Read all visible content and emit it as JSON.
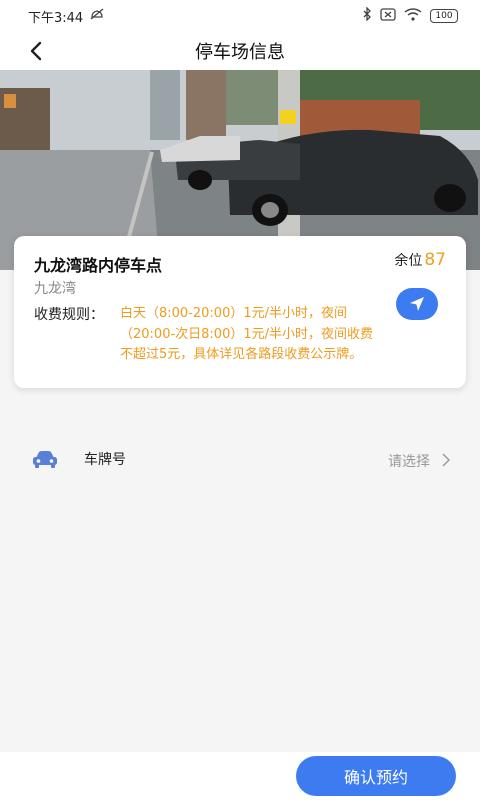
{
  "status_bar": {
    "time": "下午3:44",
    "battery": "100"
  },
  "header": {
    "title": "停车场信息"
  },
  "parking_lot": {
    "name": "九龙湾路内停车点",
    "spaces_label": "余位",
    "spaces_count": "87",
    "district": "九龙湾",
    "fee_label": "收费规则：",
    "fee_rules": "白天（8:00-20:00）1元/半小时，夜间（20:00-次日8:00）1元/半小时，夜间收费不超过5元，具体详见各路段收费公示牌。"
  },
  "plate": {
    "label": "车牌号",
    "placeholder": "请选择"
  },
  "footer": {
    "confirm_label": "确认预约"
  },
  "colors": {
    "accent": "#3d7cf0",
    "highlight": "#f0a020"
  }
}
